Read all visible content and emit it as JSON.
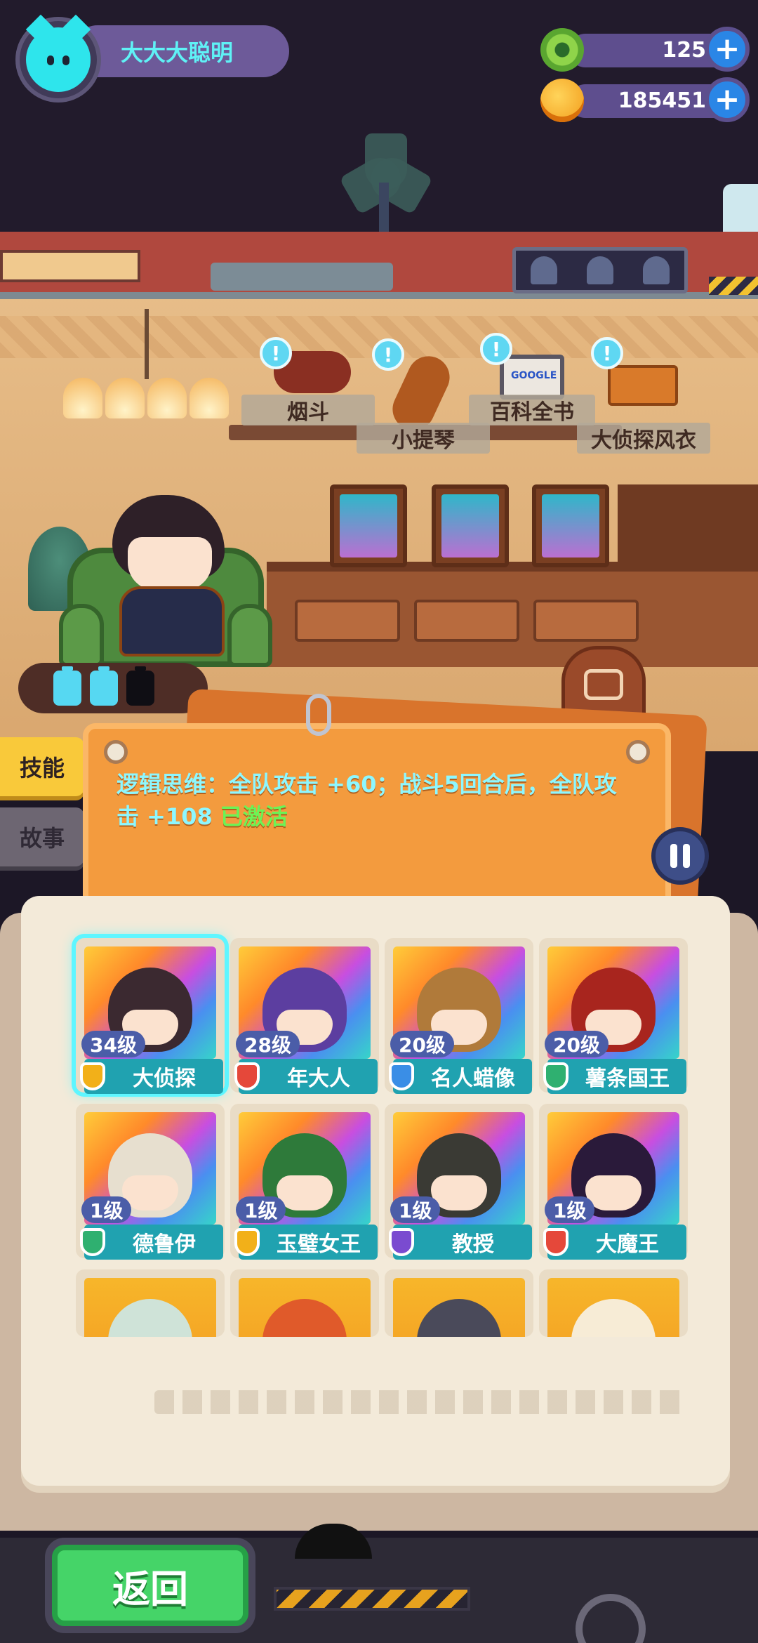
{
  "player": {
    "name": "大大大聪明"
  },
  "currencies": [
    {
      "icon": "donut-coin-icon",
      "value": "125"
    },
    {
      "icon": "planet-coin-icon",
      "value": "185451"
    }
  ],
  "room_items": [
    {
      "label": "烟斗",
      "icon": "pipe-icon"
    },
    {
      "label": "小提琴",
      "icon": "violin-icon"
    },
    {
      "label": "百科全书",
      "icon": "laptop-icon",
      "screen_text": "GOOGLE"
    },
    {
      "label": "大侦探风衣",
      "icon": "coat-icon"
    }
  ],
  "energy": {
    "filled": 2,
    "total": 3
  },
  "side_tabs": {
    "skill": "技能",
    "story": "故事"
  },
  "skill": {
    "text": "逻辑思维：全队攻击 +60；战斗5回合后，全队攻击 +108",
    "status": "已激活"
  },
  "characters": [
    {
      "level": "34级",
      "name": "大侦探",
      "badge_color": "#f2b019",
      "hair": "#3b2930",
      "selected": true
    },
    {
      "level": "28级",
      "name": "年大人",
      "badge_color": "#e5483a",
      "hair": "#5c3ea0",
      "selected": false
    },
    {
      "level": "20级",
      "name": "名人蜡像",
      "badge_color": "#3a8ee6",
      "hair": "#b07a3a",
      "selected": false
    },
    {
      "level": "20级",
      "name": "薯条国王",
      "badge_color": "#2fb070",
      "hair": "#a8251e",
      "selected": false
    },
    {
      "level": "1级",
      "name": "德鲁伊",
      "badge_color": "#2fb070",
      "hair": "#e7dfcf",
      "selected": false
    },
    {
      "level": "1级",
      "name": "玉璧女王",
      "badge_color": "#f2b019",
      "hair": "#2e7a3a",
      "selected": false
    },
    {
      "level": "1级",
      "name": "教授",
      "badge_color": "#7a4bd0",
      "hair": "#3a3a34",
      "selected": false
    },
    {
      "level": "1级",
      "name": "大魔王",
      "badge_color": "#e5483a",
      "hair": "#2a1a3a",
      "selected": false
    },
    {
      "level": "",
      "name": "",
      "badge_color": "",
      "hair": "#cfe3d8",
      "selected": false
    },
    {
      "level": "",
      "name": "",
      "badge_color": "",
      "hair": "#e05a2a",
      "selected": false
    },
    {
      "level": "",
      "name": "",
      "badge_color": "",
      "hair": "#4a4a5a",
      "selected": false
    },
    {
      "level": "",
      "name": "",
      "badge_color": "",
      "hair": "#f7ecd6",
      "selected": false
    }
  ],
  "buttons": {
    "back": "返回"
  },
  "colors": {
    "accent_cyan": "#5ef6ff",
    "panel_orange": "#f39b3e",
    "active_green": "#6bf356"
  }
}
